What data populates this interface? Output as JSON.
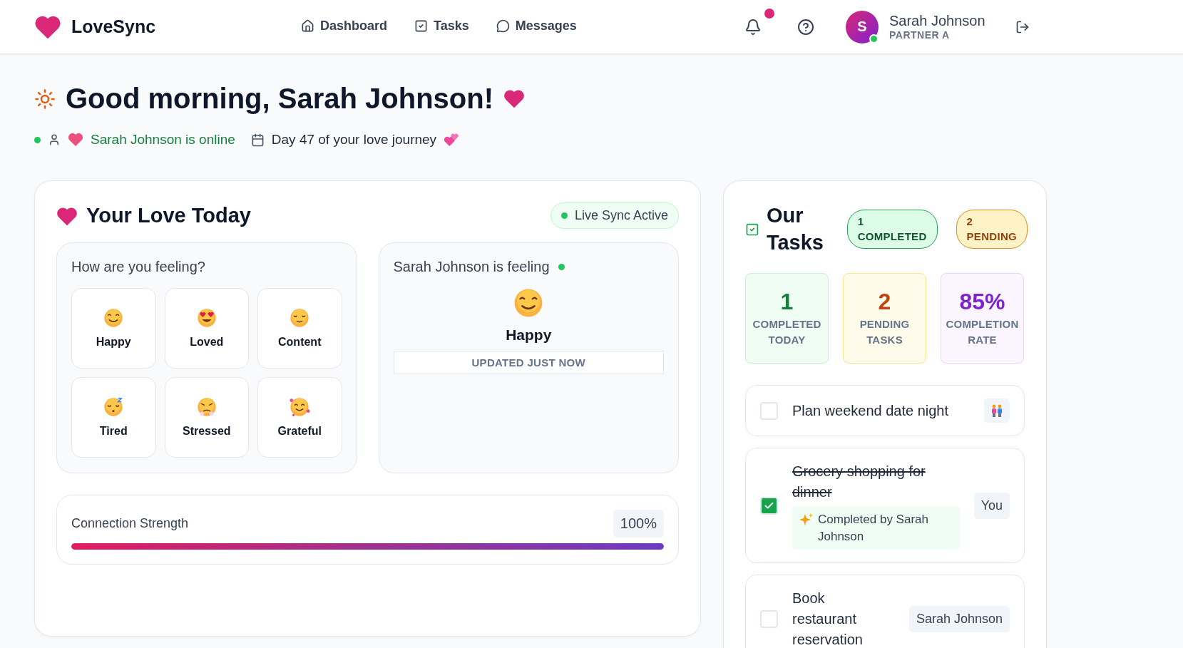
{
  "brand": {
    "name": "LoveSync"
  },
  "nav": [
    {
      "label": "Dashboard",
      "kind": "home",
      "selected": false
    },
    {
      "label": "Tasks",
      "kind": "tasks",
      "selected": false
    },
    {
      "label": "Messages",
      "kind": "messages",
      "selected": false
    }
  ],
  "user": {
    "initial": "S",
    "name": "Sarah Johnson",
    "role": "PARTNER A",
    "online": true,
    "has_notifications": true
  },
  "greeting": {
    "title": "Good morning, Sarah Johnson!",
    "partner_status": "Sarah Johnson is online",
    "journey": "Day 47 of your love journey"
  },
  "love_today": {
    "title": "Your Love Today",
    "sync_badge": "Live Sync Active",
    "my_mood": {
      "prompt": "How are you feeling?",
      "moods": [
        {
          "label": "Happy",
          "kind": "happy"
        },
        {
          "label": "Loved",
          "kind": "loved"
        },
        {
          "label": "Content",
          "kind": "content"
        },
        {
          "label": "Tired",
          "kind": "tired"
        },
        {
          "label": "Stressed",
          "kind": "stressed"
        },
        {
          "label": "Grateful",
          "kind": "grateful"
        }
      ]
    },
    "partner_mood": {
      "heading": "Sarah Johnson is feeling",
      "kind": "happy",
      "label": "Happy",
      "updated": "UPDATED JUST NOW"
    },
    "connection": {
      "label": "Connection Strength",
      "reading": "100%",
      "level": 1
    }
  },
  "tasks": {
    "title": "Our Tasks",
    "badges": [
      {
        "count": "1",
        "label": "COMPLETED",
        "kind": "completed"
      },
      {
        "count": "2",
        "label": "PENDING",
        "kind": "pending"
      }
    ],
    "stats": [
      {
        "value": "1",
        "label": "COMPLETED TODAY",
        "kind": "completed"
      },
      {
        "value": "2",
        "label": "PENDING TASKS",
        "kind": "pending"
      },
      {
        "value": "85%",
        "label": "COMPLETION RATE",
        "kind": "rate"
      }
    ],
    "items": [
      {
        "title": "Plan weekend date night",
        "checked": false,
        "assignee": {
          "kind": "couple"
        }
      },
      {
        "title": "Grocery shopping for dinner",
        "checked": true,
        "note": "Completed by Sarah Johnson",
        "assignee": {
          "kind": "person",
          "label": "You"
        }
      },
      {
        "title": "Book restaurant reservation",
        "checked": false,
        "assignee": {
          "kind": "person",
          "label": "Sarah Johnson"
        }
      }
    ]
  }
}
